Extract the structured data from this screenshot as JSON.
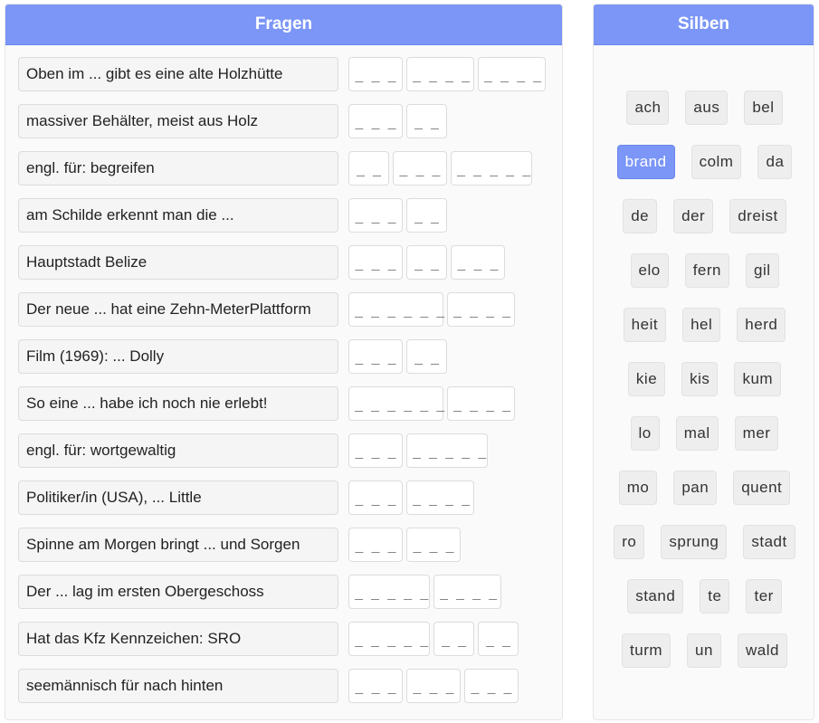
{
  "left_panel": {
    "title": "Fragen"
  },
  "right_panel": {
    "title": "Silben"
  },
  "questions": [
    {
      "text": "Oben im ... gibt es eine alte Holzhütte",
      "slots": [
        "_ _ _",
        "_ _ _ _",
        "_ _ _ _"
      ]
    },
    {
      "text": "massiver Behälter, meist aus Holz",
      "slots": [
        "_ _ _",
        "_ _"
      ]
    },
    {
      "text": "engl. für: begreifen",
      "slots": [
        "_ _",
        "_ _ _",
        "_ _ _ _ _"
      ]
    },
    {
      "text": "am Schilde erkennt man die ...",
      "slots": [
        "_ _ _",
        "_ _"
      ]
    },
    {
      "text": "Hauptstadt Belize",
      "slots": [
        "_ _ _",
        "_ _",
        "_ _ _"
      ]
    },
    {
      "text": "Der neue ... hat eine Zehn-MeterPlattform",
      "slots": [
        "_ _ _ _ _ _",
        "_ _ _ _"
      ]
    },
    {
      "text": "Film (1969): ... Dolly",
      "slots": [
        "_ _ _",
        "_ _"
      ]
    },
    {
      "text": "So eine ... habe ich noch nie erlebt!",
      "slots": [
        "_ _ _ _ _ _",
        "_ _ _ _"
      ]
    },
    {
      "text": "engl. für: wortgewaltig",
      "slots": [
        "_ _ _",
        "_ _ _ _ _"
      ]
    },
    {
      "text": "Politiker/in (USA), ... Little",
      "slots": [
        "_ _ _",
        "_ _ _ _"
      ]
    },
    {
      "text": "Spinne am Morgen bringt ... und Sorgen",
      "slots": [
        "_ _ _",
        "_ _ _"
      ]
    },
    {
      "text": "Der ... lag im ersten Obergeschoss",
      "slots": [
        "_ _ _ _ _",
        "_ _ _ _"
      ]
    },
    {
      "text": "Hat das Kfz Kennzeichen: SRO",
      "slots": [
        "_ _ _ _ _",
        "_ _",
        "_ _"
      ]
    },
    {
      "text": "seemännisch für nach hinten",
      "slots": [
        "_ _ _",
        "_ _ _",
        "_ _ _"
      ]
    }
  ],
  "syllable_rows": [
    [
      "ach",
      "aus",
      "bel"
    ],
    [
      "brand",
      "colm",
      "da"
    ],
    [
      "de",
      "der",
      "dreist"
    ],
    [
      "elo",
      "fern",
      "gil"
    ],
    [
      "heit",
      "hel",
      "herd"
    ],
    [
      "kie",
      "kis",
      "kum"
    ],
    [
      "lo",
      "mal",
      "mer"
    ],
    [
      "mo",
      "pan",
      "quent"
    ],
    [
      "ro",
      "sprung",
      "stadt"
    ],
    [
      "stand",
      "te",
      "ter"
    ],
    [
      "turm",
      "un",
      "wald"
    ]
  ],
  "selected_syllable": "brand",
  "colors": {
    "accent": "#7b96f7",
    "chip_bg": "#eeeeee",
    "panel_bg": "#fafafa"
  }
}
